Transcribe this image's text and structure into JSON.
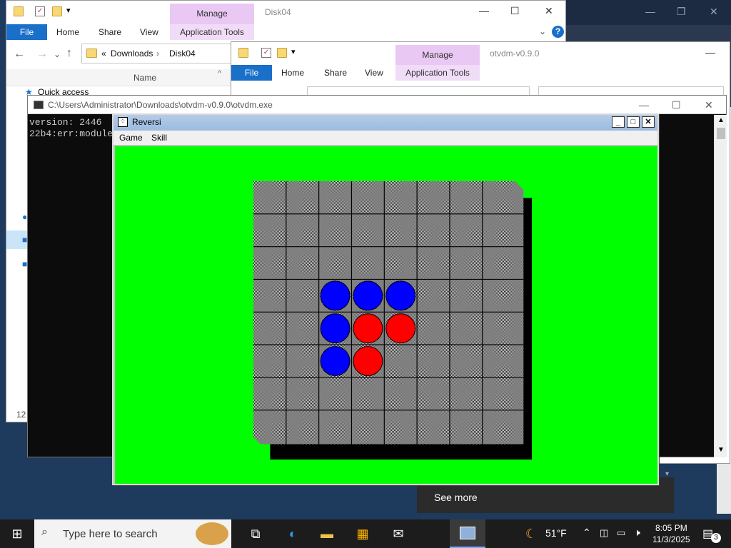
{
  "explorer1": {
    "tabs": {
      "file": "File",
      "home": "Home",
      "share": "Share",
      "view": "View",
      "app_tools": "Application Tools"
    },
    "manage": "Manage",
    "title": "Disk04",
    "breadcrumb": {
      "prefix": "«",
      "parts": [
        "Downloads",
        "Disk04"
      ]
    },
    "column_header": "Name",
    "nav_item": "Quick access",
    "status": "12"
  },
  "explorer2": {
    "tabs": {
      "file": "File",
      "home": "Home",
      "share": "Share",
      "view": "View",
      "app_tools": "Application Tools"
    },
    "manage": "Manage",
    "title": "otvdm-v0.9.0"
  },
  "console": {
    "title": "C:\\Users\\Administrator\\Downloads\\otvdm-v0.9.0\\otvdm.exe",
    "lines": [
      "version: 2446",
      "22b4:err:module"
    ]
  },
  "reversi": {
    "title": "Reversi",
    "menu": [
      "Game",
      "Skill"
    ],
    "colors": {
      "field": "#00ff00",
      "player": "#0000ff",
      "computer": "#ff0000"
    },
    "board": [
      [
        "",
        "",
        "",
        "",
        "",
        "",
        "",
        ""
      ],
      [
        "",
        "",
        "",
        "",
        "",
        "",
        "",
        ""
      ],
      [
        "",
        "",
        "",
        "",
        "",
        "",
        "",
        ""
      ],
      [
        "",
        "",
        "B",
        "B",
        "B",
        "",
        "",
        ""
      ],
      [
        "",
        "",
        "B",
        "R",
        "R",
        "",
        "",
        ""
      ],
      [
        "",
        "",
        "B",
        "R",
        "",
        "",
        "",
        ""
      ],
      [
        "",
        "",
        "",
        "",
        "",
        "",
        "",
        ""
      ],
      [
        "",
        "",
        "",
        "",
        "",
        "",
        "",
        ""
      ]
    ]
  },
  "toast": {
    "see_more": "See more"
  },
  "taskbar": {
    "search_placeholder": "Type here to search",
    "weather": "51°F",
    "time": "8:05 PM",
    "date": "11/3/2025",
    "notification_count": "3"
  }
}
